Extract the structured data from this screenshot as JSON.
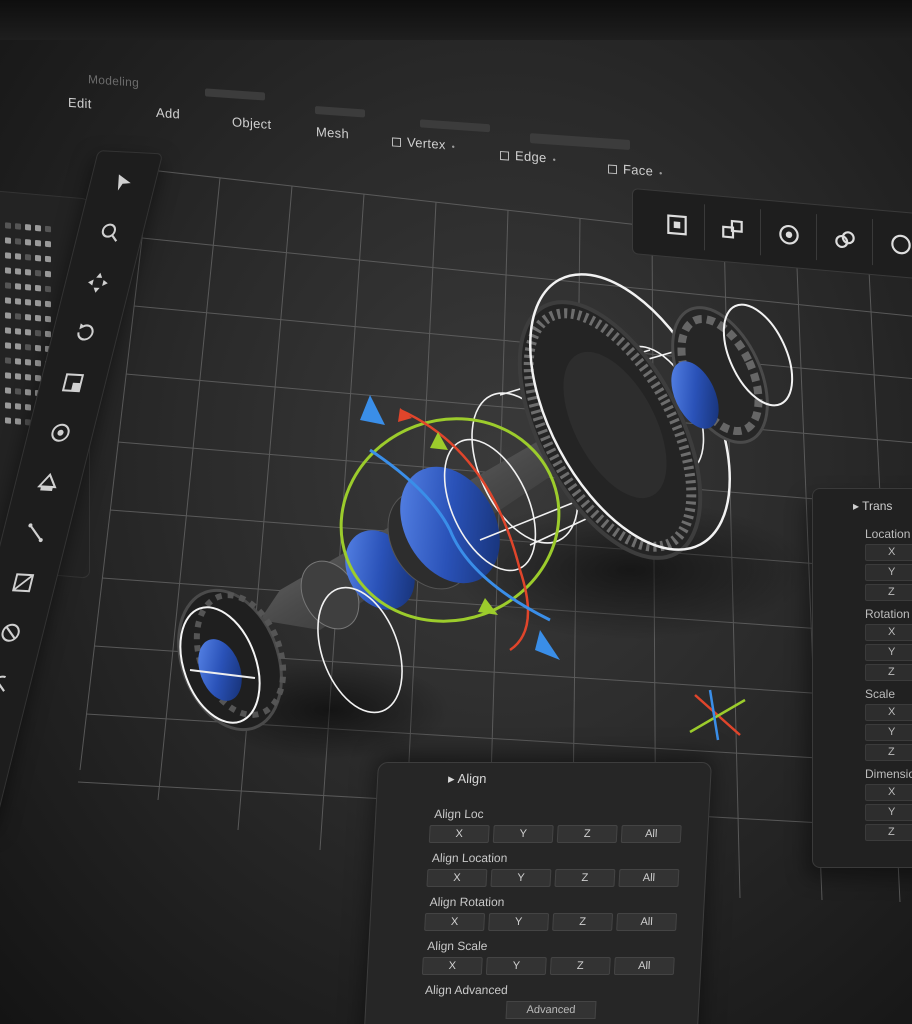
{
  "menubar": {
    "row1": [
      "Modeling",
      "",
      "",
      "",
      ""
    ],
    "tabs": [
      "Edit",
      "Add",
      "Object",
      "Mesh"
    ],
    "modes": [
      {
        "label": "Vertex",
        "icon": "vertex-box-icon"
      },
      {
        "label": "Edge",
        "icon": "edge-box-icon"
      },
      {
        "label": "Face",
        "icon": "face-box-icon"
      }
    ]
  },
  "tools": [
    "select-cursor-icon",
    "zoom-icon",
    "move-icon",
    "rotate-icon",
    "scale-icon",
    "transform-icon",
    "extrude-icon",
    "knife-icon",
    "bevel-icon",
    "loop-cut-icon",
    "measure-icon",
    "object-icon",
    "add-object-icon"
  ],
  "modebar": [
    "object-mode-icon",
    "edit-mode-icon",
    "sculpt-mode-icon",
    "link-icon",
    "circle-icon"
  ],
  "transform_panel": {
    "header": "Trans",
    "sections": [
      {
        "label": "Location",
        "fields": [
          "X",
          "Y",
          "Z"
        ]
      },
      {
        "label": "Rotation",
        "fields": [
          "X",
          "Y",
          "Z"
        ]
      },
      {
        "label": "Scale",
        "fields": [
          "X",
          "Y",
          "Z"
        ]
      },
      {
        "label": "Dimensions",
        "fields": [
          "X",
          "Y",
          "Z"
        ]
      }
    ]
  },
  "align_panel": {
    "header": "Align",
    "sections": [
      {
        "label": "Align Loc",
        "buttons": [
          "X",
          "Y",
          "Z",
          "All"
        ]
      },
      {
        "label": "Align Location",
        "buttons": [
          "X",
          "Y",
          "Z",
          "All"
        ]
      },
      {
        "label": "Align Rotation",
        "buttons": [
          "X",
          "Y",
          "Z",
          "All"
        ]
      },
      {
        "label": "Align Scale",
        "buttons": [
          "X",
          "Y",
          "Z",
          "All"
        ]
      },
      {
        "label": "Align Advanced",
        "buttons": []
      }
    ],
    "footer": "Advanced"
  },
  "colors": {
    "accent_blue": "#2f5fd0",
    "gizmo_red": "#e0452b",
    "gizmo_green": "#9ccc2c",
    "gizmo_blue": "#3a8ee8",
    "grid": "#6a6a6a"
  }
}
